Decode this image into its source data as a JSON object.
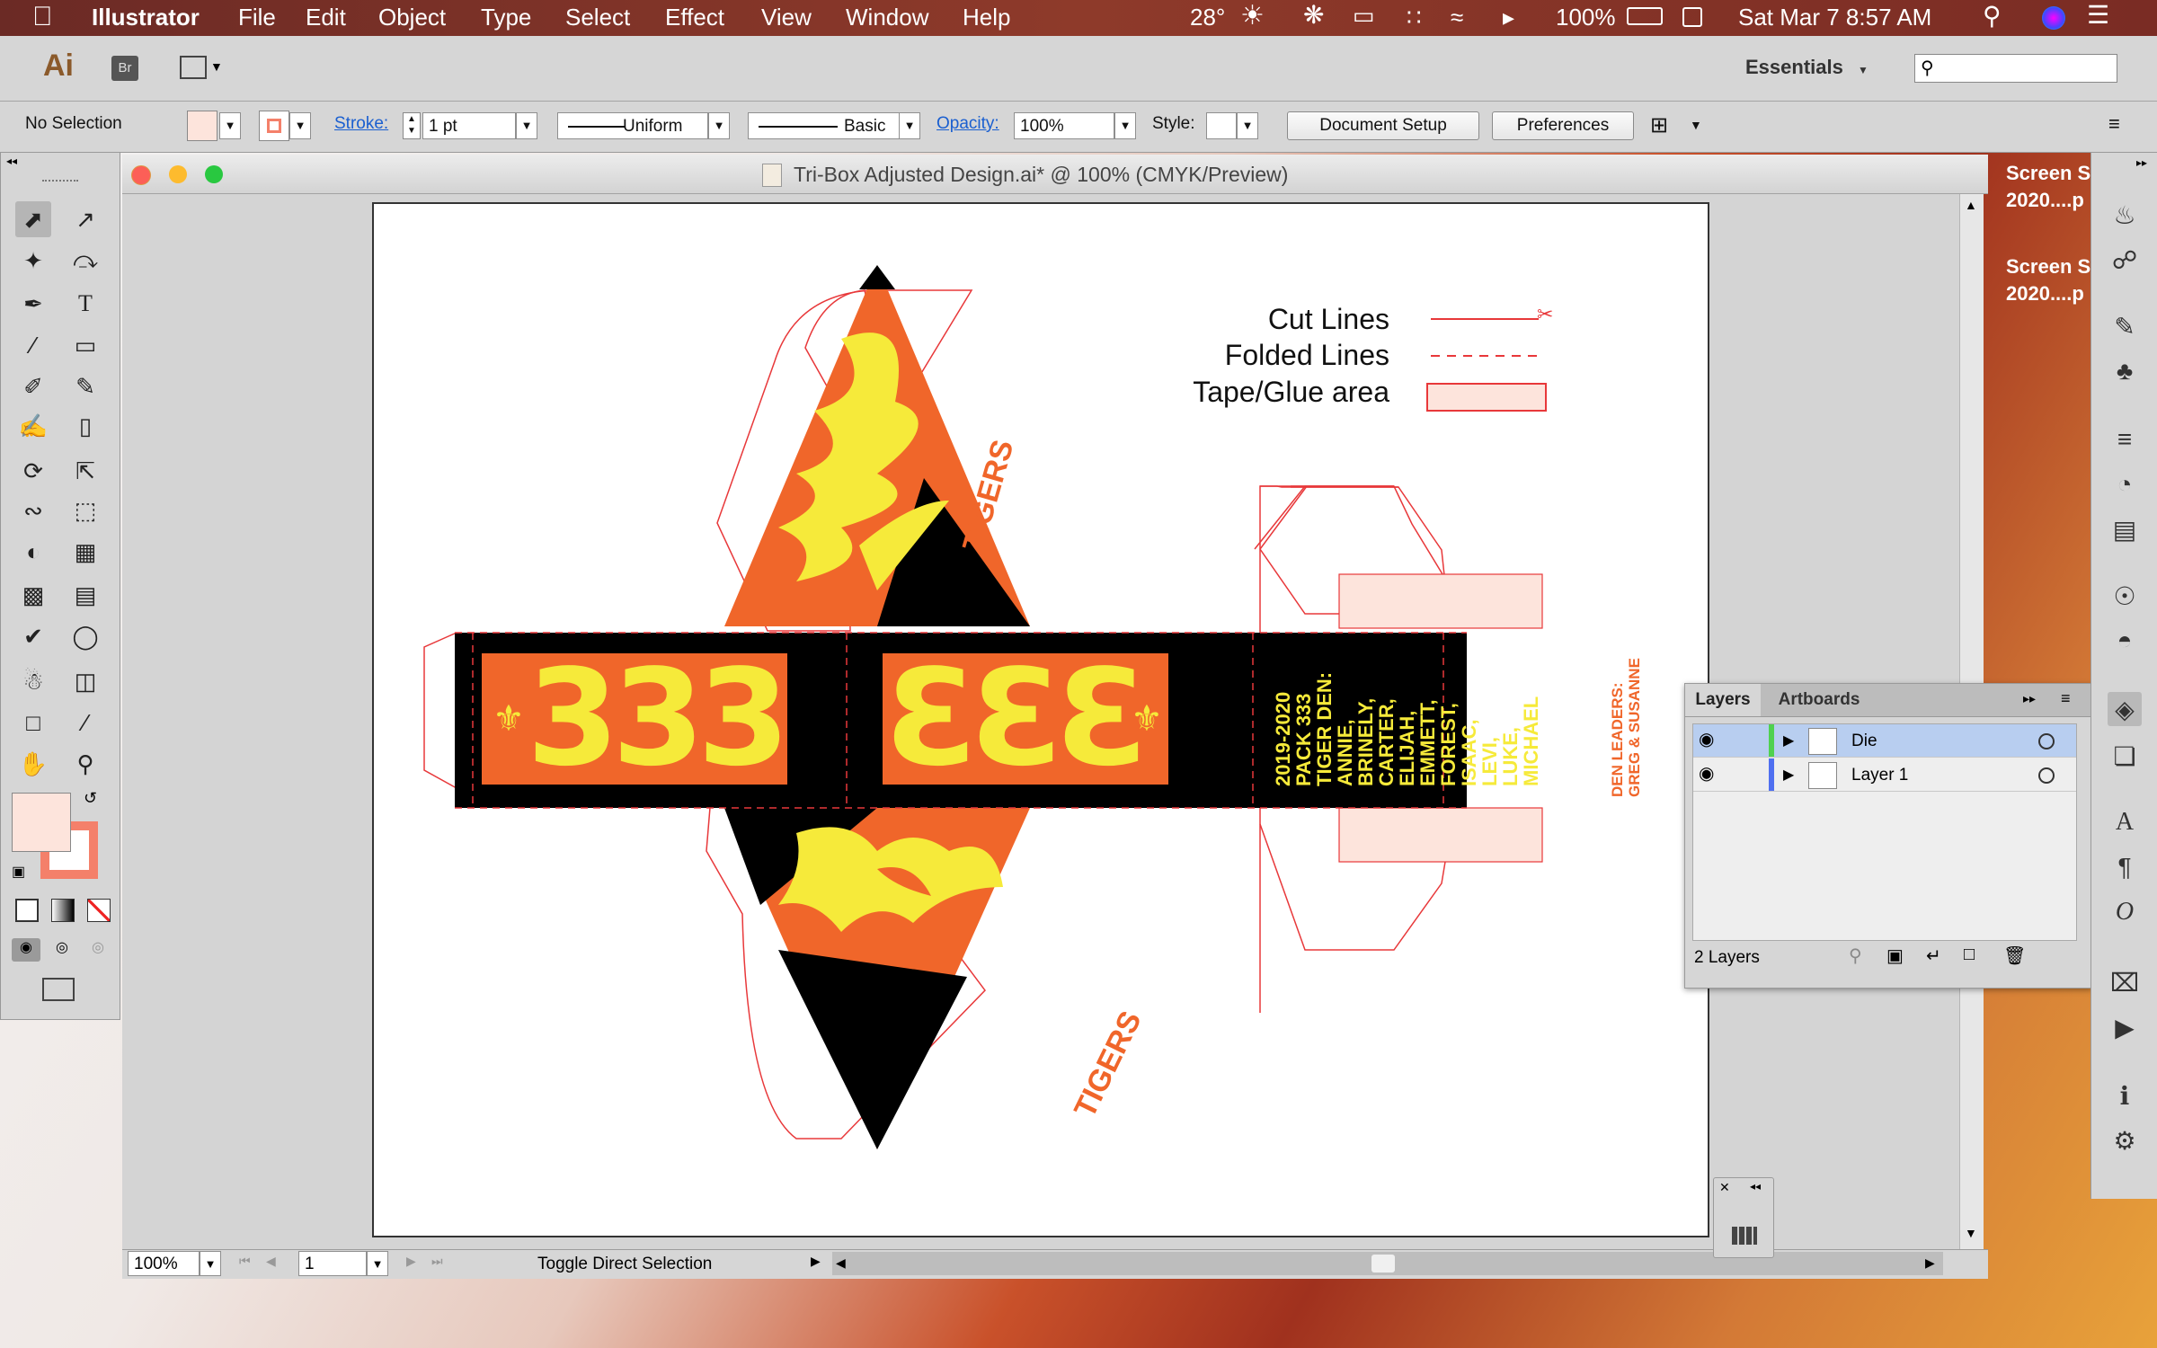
{
  "menubar": {
    "apple_icon": "apple-icon",
    "app_name": "Illustrator",
    "menus": [
      "File",
      "Edit",
      "Object",
      "Type",
      "Select",
      "Effect",
      "View",
      "Window",
      "Help"
    ],
    "weather": "28°",
    "battery": "100%",
    "datetime": "Sat Mar 7  8:57 AM"
  },
  "appbar": {
    "ai_logo": "Ai",
    "bridge_logo": "Br",
    "workspace": "Essentials",
    "search_placeholder": ""
  },
  "control": {
    "selection_status": "No Selection",
    "stroke_label": "Stroke:",
    "stroke_weight": "1 pt",
    "profile": "Uniform",
    "brush": "Basic",
    "opacity_label": "Opacity:",
    "opacity": "100%",
    "style_label": "Style:",
    "document_setup": "Document Setup",
    "preferences": "Preferences"
  },
  "document": {
    "title": "Tri-Box Adjusted Design.ai* @ 100% (CMYK/Preview)"
  },
  "artwork": {
    "legend": {
      "cut": "Cut Lines",
      "fold": "Folded Lines",
      "glue": "Tape/Glue area"
    },
    "pack_number": "333",
    "tigers_text": "TIGERS",
    "den_lines": [
      "2019-2020",
      "PACK 333",
      "TIGER DEN:",
      "ANNIE,",
      "BRINELY,",
      "CARTER,",
      "ELIJAH,",
      "EMMETT,",
      "FOREST,",
      "ISAAC,",
      "LEVI,",
      "LUKE,",
      "MICHAEL"
    ],
    "leaders_lines": [
      "DEN LEADERS:",
      "GREG & SUSANNE"
    ],
    "colors": {
      "orange": "#f0662a",
      "yellow": "#f6ea3a",
      "black": "#000000",
      "cut_red": "#e8383a",
      "glue_pink": "#fde4dc"
    }
  },
  "status": {
    "zoom": "100%",
    "artboard_number": "1",
    "hint": "Toggle Direct Selection"
  },
  "layers_panel": {
    "tabs": [
      "Layers",
      "Artboards"
    ],
    "layers": [
      {
        "name": "Die",
        "color": "#4fd14f"
      },
      {
        "name": "Layer 1",
        "color": "#4f6ff0"
      }
    ],
    "count": "2 Layers"
  },
  "desktop_files": [
    {
      "line1": "Screen S",
      "line2": "2020....p"
    },
    {
      "line1": "Screen S",
      "line2": "2020....p"
    }
  ],
  "colors": {
    "fill_swatch": "#fde4dc",
    "stroke_swatch": "#f4806a"
  }
}
